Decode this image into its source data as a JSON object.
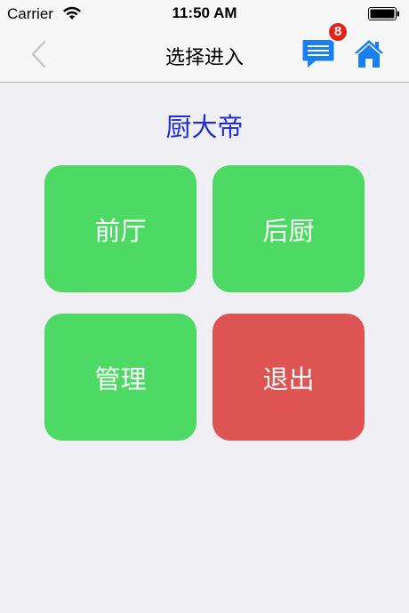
{
  "status_bar": {
    "carrier": "Carrier",
    "time": "11:50 AM",
    "icons": [
      "wifi-icon",
      "battery-icon"
    ]
  },
  "nav_bar": {
    "title": "选择进入",
    "back_icon": "chevron-left-icon",
    "message_icon": "chat-message-icon",
    "message_badge": "8",
    "home_icon": "home-icon"
  },
  "main": {
    "brand_title": "厨大帝",
    "tiles": [
      {
        "label": "前厅",
        "color": "#4cd964"
      },
      {
        "label": "后厨",
        "color": "#4cd964"
      },
      {
        "label": "管理",
        "color": "#4cd964"
      },
      {
        "label": "退出",
        "color": "#de5453"
      }
    ]
  },
  "colors": {
    "accent_blue": "#1a7ff0",
    "title_blue": "#1f2ed6",
    "tile_green": "#4cd964",
    "tile_red": "#de5453",
    "badge_red": "#e0241c",
    "background": "#efeff4"
  }
}
